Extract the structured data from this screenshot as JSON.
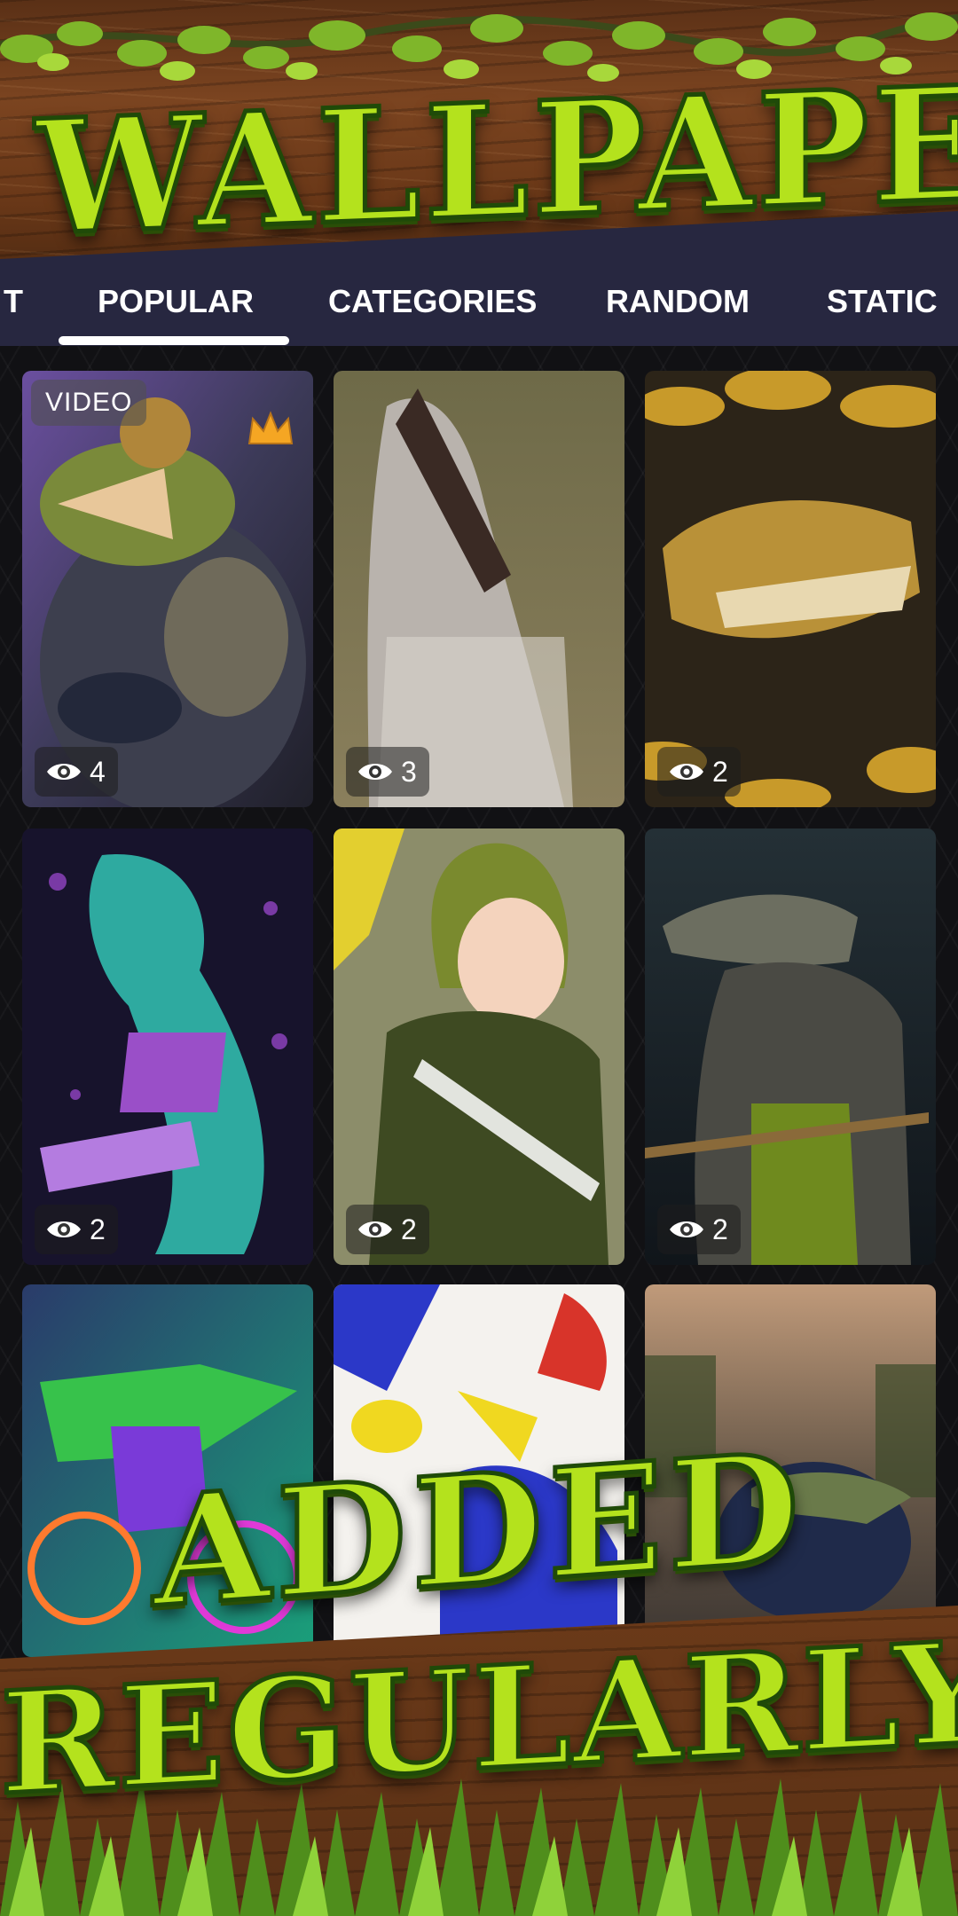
{
  "banner": {
    "title": "WALLPAPER"
  },
  "tabs": [
    {
      "label": "T",
      "active": false
    },
    {
      "label": "POPULAR",
      "active": true
    },
    {
      "label": "CATEGORIES",
      "active": false
    },
    {
      "label": "RANDOM",
      "active": false
    },
    {
      "label": "STATIC",
      "active": false
    }
  ],
  "grid": {
    "items": [
      {
        "subject": "gamer crocodile with headset",
        "views": "4",
        "badge": "VIDEO",
        "premium_icon": "crown-icon"
      },
      {
        "subject": "alligator head photo",
        "views": "3"
      },
      {
        "subject": "golden crocodile among leaves",
        "views": "2"
      },
      {
        "subject": "skateboarding dinosaur",
        "views": "2"
      },
      {
        "subject": "anime girl with crocodile",
        "views": "2"
      },
      {
        "subject": "samurai crocodile",
        "views": "2"
      },
      {
        "subject": "neon crocodile on bicycle",
        "views": ""
      },
      {
        "subject": "comic-style art",
        "views": ""
      },
      {
        "subject": "crocodile in city street",
        "views": ""
      }
    ]
  },
  "promo": {
    "line1": "ADDED",
    "line2": "REGULARLY"
  },
  "colors": {
    "tabbar": "#272740",
    "title_green": "#b4e21d",
    "wood": "#6b3a19"
  },
  "icons": {
    "views": "eye-icon",
    "premium": "crown-icon"
  }
}
